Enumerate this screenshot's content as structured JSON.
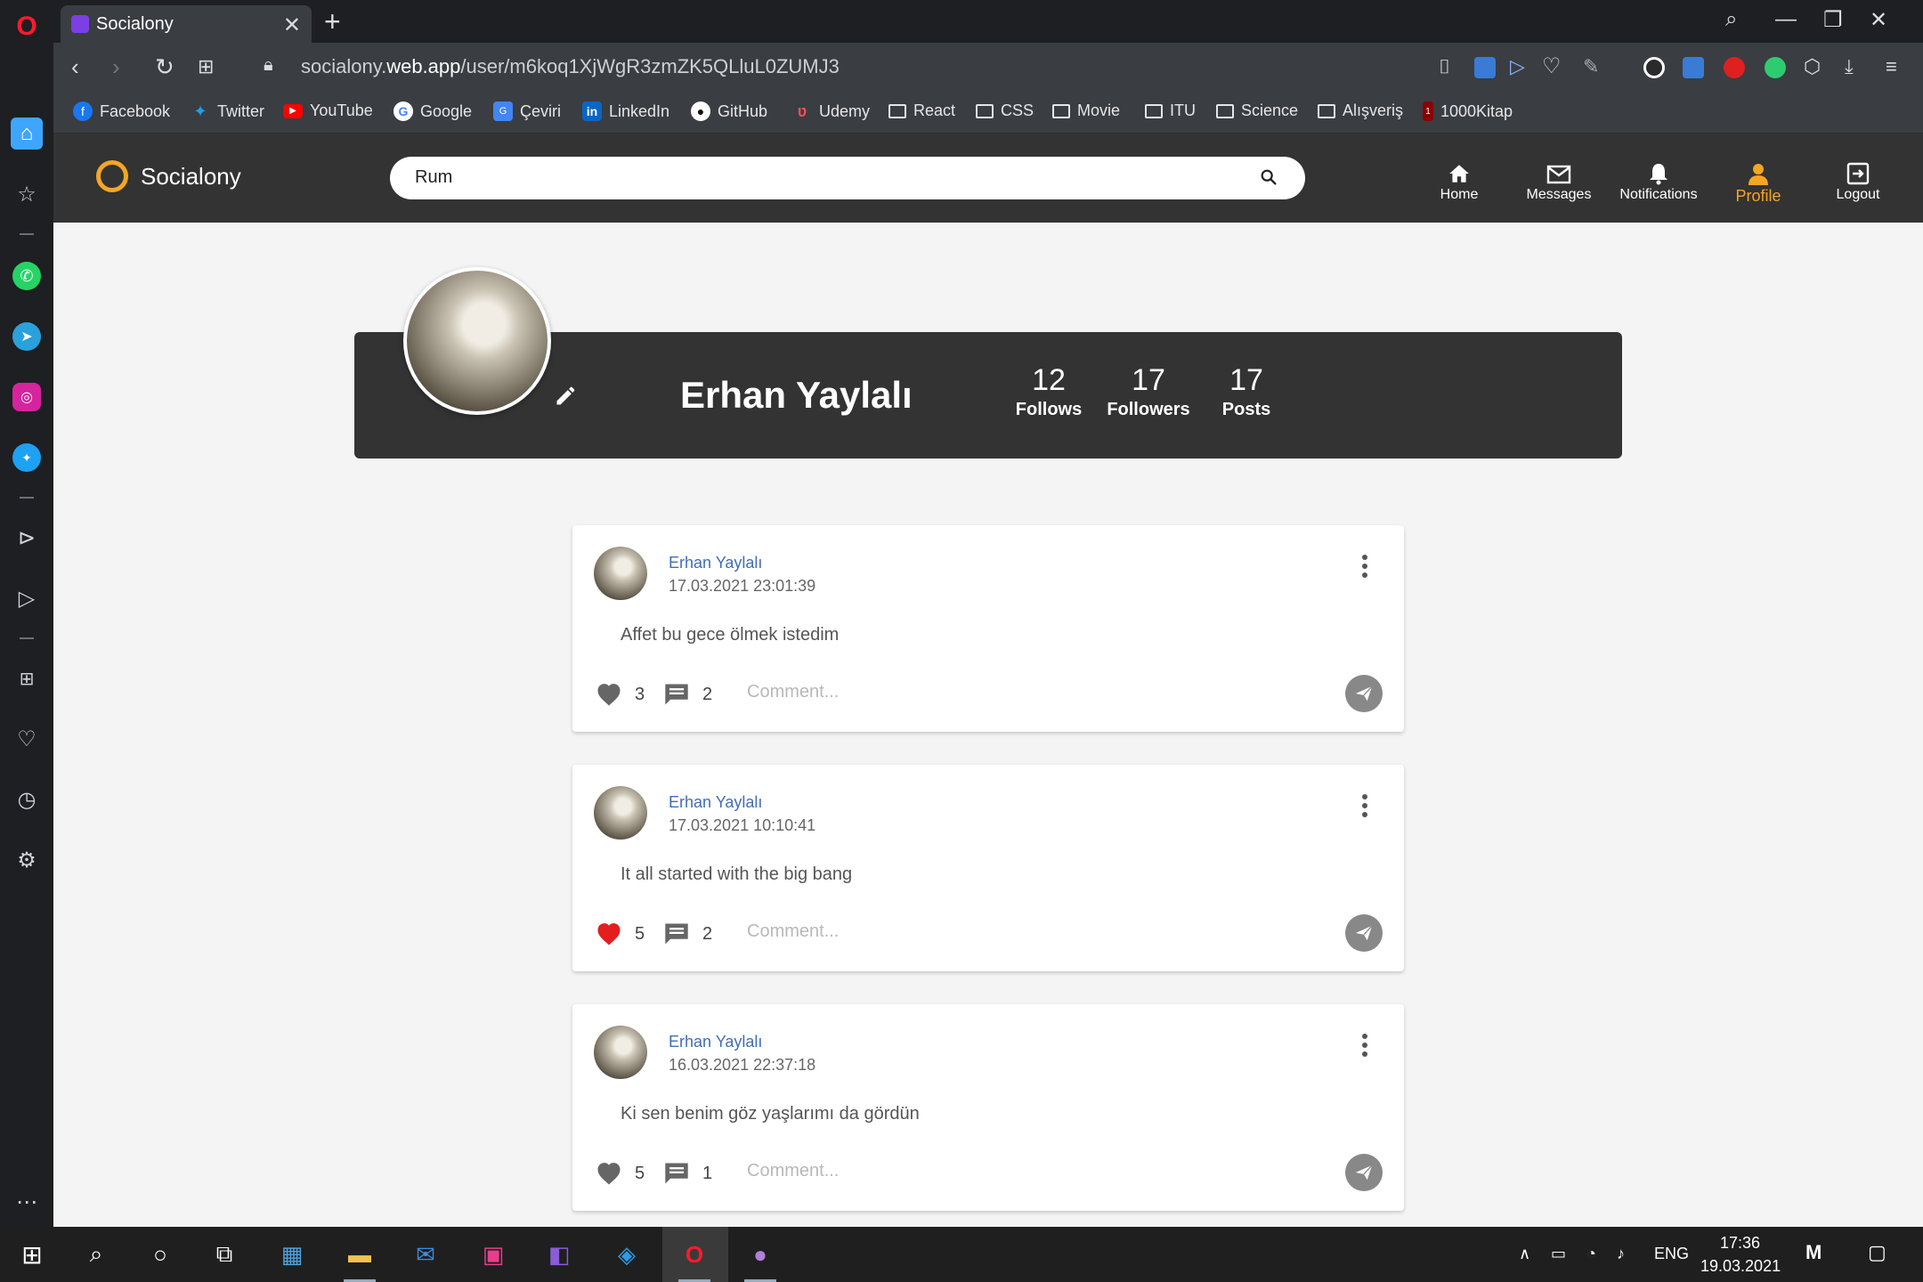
{
  "browser": {
    "tab_title": "Socialony",
    "url_prefix": "socialony.",
    "url_domain": "web.app",
    "url_path": "/user/m6koq1XjWgR3zmZK5QLluL0ZUMJ3"
  },
  "bookmarks": [
    {
      "label": "Facebook",
      "icon": "facebook-icon",
      "color": "#1877f2"
    },
    {
      "label": "Twitter",
      "icon": "twitter-icon",
      "color": "#1da1f2"
    },
    {
      "label": "YouTube",
      "icon": "youtube-icon",
      "color": "#ff0000"
    },
    {
      "label": "Google",
      "icon": "google-icon",
      "color": "#ffffff"
    },
    {
      "label": "Çeviri",
      "icon": "translate-icon",
      "color": "#4285f4"
    },
    {
      "label": "LinkedIn",
      "icon": "linkedin-icon",
      "color": "#0a66c2"
    },
    {
      "label": "GitHub",
      "icon": "github-icon",
      "color": "#ffffff"
    },
    {
      "label": "Udemy",
      "icon": "udemy-icon",
      "color": "#ec5252"
    },
    {
      "label": "React",
      "icon": "folder-icon"
    },
    {
      "label": "CSS",
      "icon": "folder-icon"
    },
    {
      "label": "Movie",
      "icon": "folder-icon"
    },
    {
      "label": "ITU",
      "icon": "folder-icon"
    },
    {
      "label": "Science",
      "icon": "folder-icon"
    },
    {
      "label": "Alışveriş",
      "icon": "folder-icon"
    },
    {
      "label": "1000Kitap",
      "icon": "book-icon",
      "color": "#8b0000"
    }
  ],
  "app": {
    "brand": "Socialony",
    "search_value": "Rum",
    "nav": {
      "home": "Home",
      "messages": "Messages",
      "notifications": "Notifications",
      "profile": "Profile",
      "logout": "Logout"
    },
    "accent_color": "#f5a623"
  },
  "profile": {
    "name": "Erhan Yaylalı",
    "stats": [
      {
        "value": "12",
        "label": "Follows"
      },
      {
        "value": "17",
        "label": "Followers"
      },
      {
        "value": "17",
        "label": "Posts"
      }
    ]
  },
  "posts": [
    {
      "author": "Erhan Yaylalı",
      "date": "17.03.2021 23:01:39",
      "text": "Affet bu gece ölmek istedim",
      "likes": "3",
      "liked": false,
      "comments": "2",
      "comment_placeholder": "Comment..."
    },
    {
      "author": "Erhan Yaylalı",
      "date": "17.03.2021 10:10:41",
      "text": "It all started with the big bang",
      "likes": "5",
      "liked": true,
      "comments": "2",
      "comment_placeholder": "Comment..."
    },
    {
      "author": "Erhan Yaylalı",
      "date": "16.03.2021 22:37:18",
      "text": "Ki sen benim göz yaşlarımı da gördün",
      "likes": "5",
      "liked": false,
      "comments": "1",
      "comment_placeholder": "Comment..."
    }
  ],
  "taskbar": {
    "language": "ENG",
    "time": "17:36",
    "date": "19.03.2021"
  }
}
